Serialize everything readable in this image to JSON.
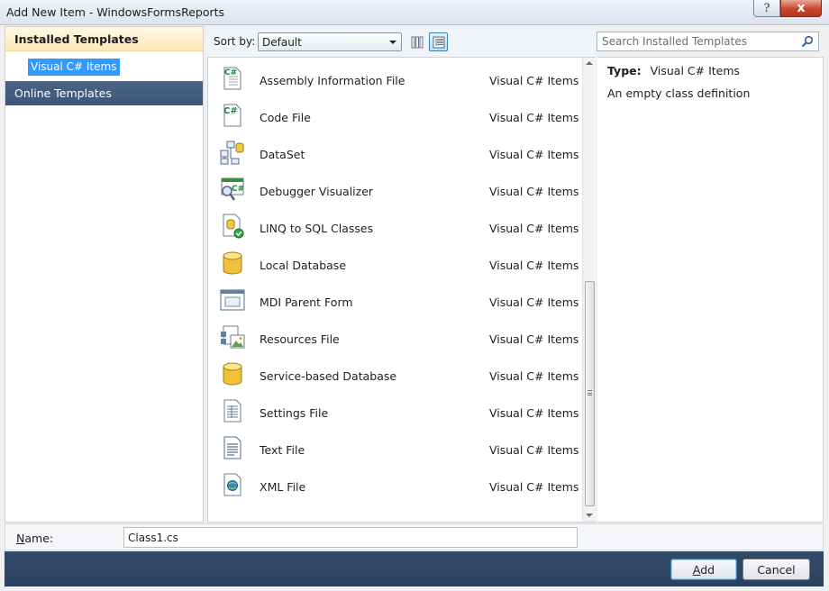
{
  "window": {
    "title": "Add New Item - WindowsFormsReports",
    "help_glyph": "?",
    "close_glyph": "x"
  },
  "left_pane": {
    "installed_header": "Installed Templates",
    "selected_item": "Visual C# Items",
    "online_templates": "Online Templates"
  },
  "toolbar": {
    "sort_label": "Sort by:",
    "sort_value": "Default",
    "view_medium_icons": "medium-icons-view",
    "view_small_icons": "small-icons-view"
  },
  "search": {
    "placeholder": "Search Installed Templates"
  },
  "templates": [
    {
      "name": "Assembly Information File",
      "category": "Visual C# Items",
      "icon": "cs-document-icon"
    },
    {
      "name": "Code File",
      "category": "Visual C# Items",
      "icon": "cs-code-icon"
    },
    {
      "name": "DataSet",
      "category": "Visual C# Items",
      "icon": "dataset-icon"
    },
    {
      "name": "Debugger Visualizer",
      "category": "Visual C# Items",
      "icon": "debugger-visualizer-icon"
    },
    {
      "name": "LINQ to SQL Classes",
      "category": "Visual C# Items",
      "icon": "linq-sql-icon"
    },
    {
      "name": "Local Database",
      "category": "Visual C# Items",
      "icon": "database-icon"
    },
    {
      "name": "MDI Parent Form",
      "category": "Visual C# Items",
      "icon": "form-icon"
    },
    {
      "name": "Resources File",
      "category": "Visual C# Items",
      "icon": "resources-icon"
    },
    {
      "name": "Service-based Database",
      "category": "Visual C# Items",
      "icon": "database-icon"
    },
    {
      "name": "Settings File",
      "category": "Visual C# Items",
      "icon": "settings-icon"
    },
    {
      "name": "Text File",
      "category": "Visual C# Items",
      "icon": "text-file-icon"
    },
    {
      "name": "XML File",
      "category": "Visual C# Items",
      "icon": "xml-file-icon"
    }
  ],
  "details": {
    "type_label": "Type:",
    "type_value": "Visual C# Items",
    "description": "An empty class definition"
  },
  "name_field": {
    "label": "Name:",
    "value": "Class1.cs"
  },
  "buttons": {
    "add": "Add",
    "cancel": "Cancel"
  },
  "colors": {
    "selection": "#3399ff",
    "online_band": "#3d5577",
    "button_bar": "#2f4566",
    "installed_header": "#fde9b8"
  }
}
